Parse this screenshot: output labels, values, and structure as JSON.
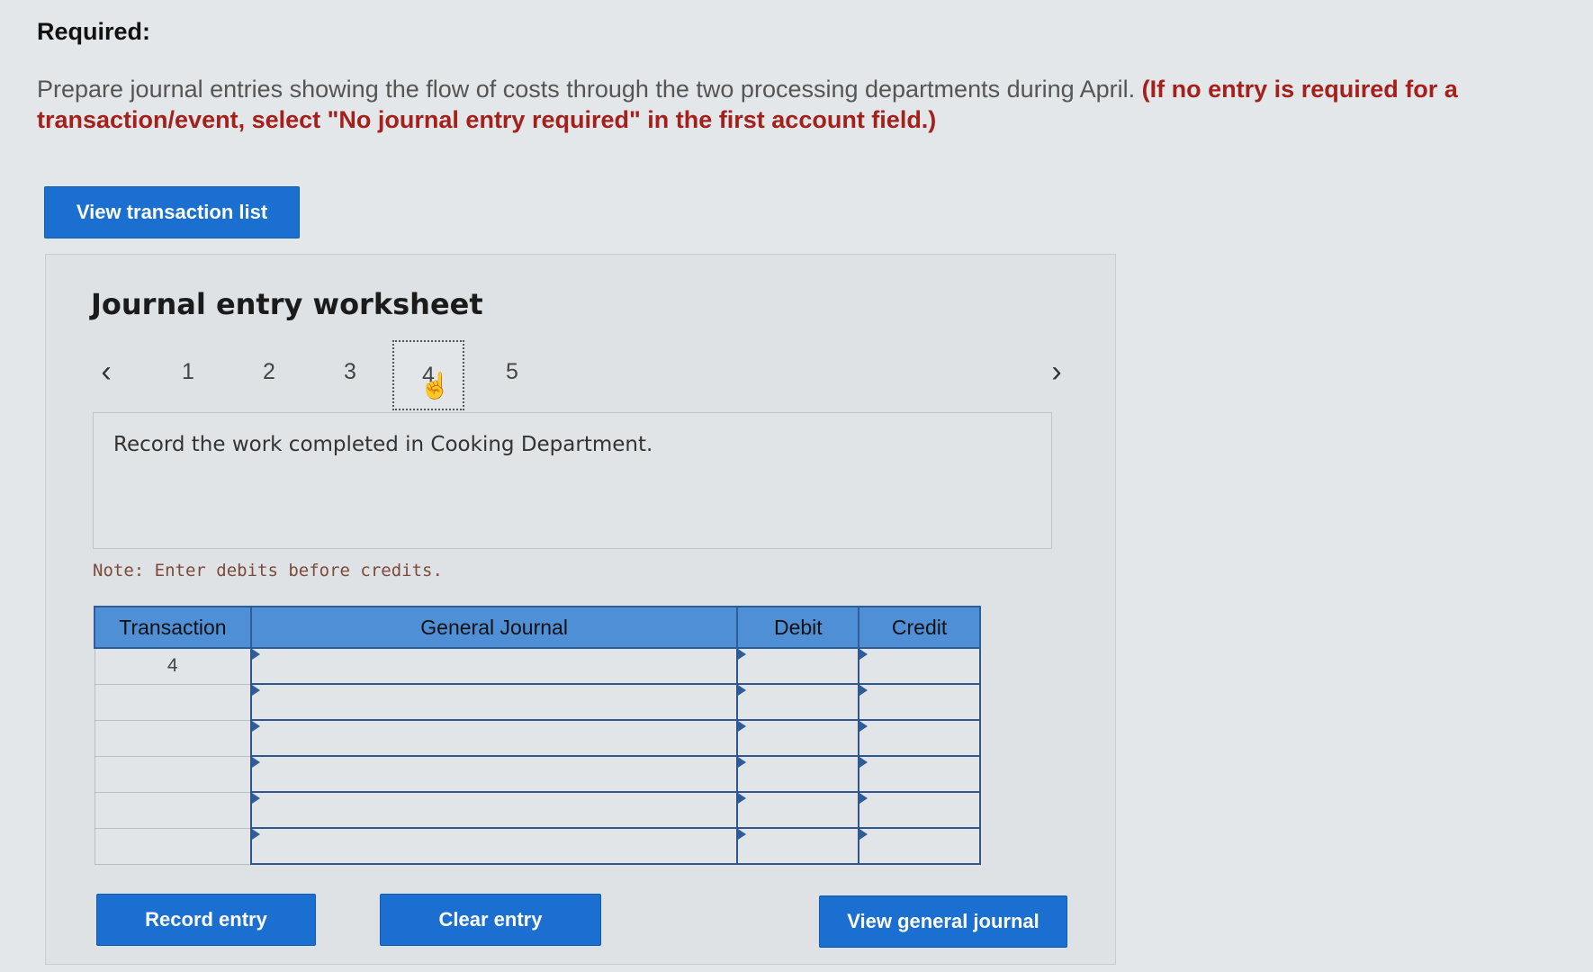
{
  "header": {
    "required_label": "Required:",
    "instruction_plain": "Prepare journal entries showing the flow of costs through the two processing departments during April. ",
    "instruction_bold": "(If no entry is required for a transaction/event, select \"No journal entry required\" in the first account field.)"
  },
  "buttons": {
    "view_transaction_list": "View transaction list",
    "record_entry": "Record entry",
    "clear_entry": "Clear entry",
    "view_general_journal": "View general journal"
  },
  "worksheet": {
    "title": "Journal entry worksheet",
    "pages": [
      "1",
      "2",
      "3",
      "4",
      "5"
    ],
    "active_page": "4",
    "description": "Record the work completed in Cooking Department.",
    "note": "Note: Enter debits before credits."
  },
  "journal_table": {
    "headers": [
      "Transaction",
      "General Journal",
      "Debit",
      "Credit"
    ],
    "rows": [
      {
        "transaction": "4",
        "account": "",
        "debit": "",
        "credit": ""
      },
      {
        "transaction": "",
        "account": "",
        "debit": "",
        "credit": ""
      },
      {
        "transaction": "",
        "account": "",
        "debit": "",
        "credit": ""
      },
      {
        "transaction": "",
        "account": "",
        "debit": "",
        "credit": ""
      },
      {
        "transaction": "",
        "account": "",
        "debit": "",
        "credit": ""
      },
      {
        "transaction": "",
        "account": "",
        "debit": "",
        "credit": ""
      }
    ]
  },
  "icons": {
    "prev": "chevron-left-icon",
    "next": "chevron-right-icon",
    "cursor": "hand-pointer-icon"
  },
  "colors": {
    "button_blue": "#1a6fd1",
    "header_blue": "#4f8fd6",
    "accent_red": "#a3201b"
  }
}
